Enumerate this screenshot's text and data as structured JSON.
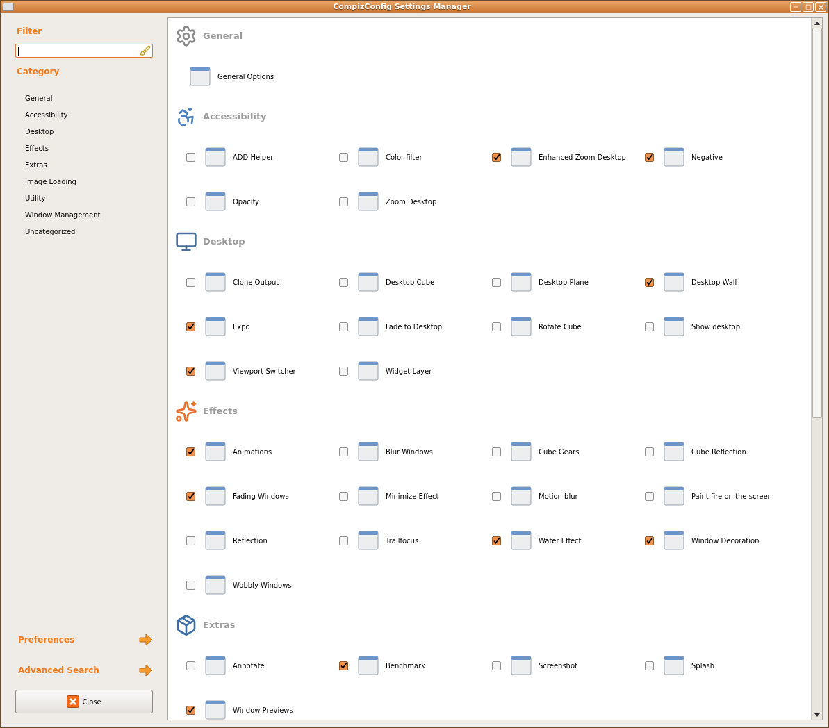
{
  "window": {
    "title": "CompizConfig Settings Manager"
  },
  "sidebar": {
    "filter_label": "Filter",
    "category_label": "Category",
    "categories": [
      "General",
      "Accessibility",
      "Desktop",
      "Effects",
      "Extras",
      "Image Loading",
      "Utility",
      "Window Management",
      "Uncategorized"
    ],
    "links": [
      "Preferences",
      "Advanced Search"
    ],
    "close_button": "Close"
  },
  "sections": [
    {
      "title": "General",
      "items": [
        {
          "label": "General Options",
          "kind": "plain"
        }
      ]
    },
    {
      "title": "Accessibility",
      "items": [
        {
          "label": "ADD Helper",
          "kind": "plugin",
          "checked": false
        },
        {
          "label": "Color filter",
          "kind": "plugin",
          "checked": false
        },
        {
          "label": "Enhanced Zoom Desktop",
          "kind": "plugin",
          "checked": true
        },
        {
          "label": "Negative",
          "kind": "plugin",
          "checked": true
        },
        {
          "label": "Opacify",
          "kind": "plugin",
          "checked": false
        },
        {
          "label": "Zoom Desktop",
          "kind": "plugin",
          "checked": false
        }
      ]
    },
    {
      "title": "Desktop",
      "items": [
        {
          "label": "Clone Output",
          "kind": "plugin",
          "checked": false
        },
        {
          "label": "Desktop Cube",
          "kind": "plugin",
          "checked": false
        },
        {
          "label": "Desktop Plane",
          "kind": "plugin",
          "checked": false
        },
        {
          "label": "Desktop Wall",
          "kind": "plugin",
          "checked": true
        },
        {
          "label": "Expo",
          "kind": "plugin",
          "checked": true
        },
        {
          "label": "Fade to Desktop",
          "kind": "plugin",
          "checked": false
        },
        {
          "label": "Rotate Cube",
          "kind": "plugin",
          "checked": false
        },
        {
          "label": "Show desktop",
          "kind": "plugin",
          "checked": false
        },
        {
          "label": "Viewport Switcher",
          "kind": "plugin",
          "checked": true
        },
        {
          "label": "Widget Layer",
          "kind": "plugin",
          "checked": false
        }
      ]
    },
    {
      "title": "Effects",
      "items": [
        {
          "label": "Animations",
          "kind": "plugin",
          "checked": true
        },
        {
          "label": "Blur Windows",
          "kind": "plugin",
          "checked": false
        },
        {
          "label": "Cube Gears",
          "kind": "plugin",
          "checked": false
        },
        {
          "label": "Cube Reflection",
          "kind": "plugin",
          "checked": false
        },
        {
          "label": "Fading Windows",
          "kind": "plugin",
          "checked": true
        },
        {
          "label": "Minimize Effect",
          "kind": "plugin",
          "checked": false
        },
        {
          "label": "Motion blur",
          "kind": "plugin",
          "checked": false
        },
        {
          "label": "Paint fire on the screen",
          "kind": "plugin",
          "checked": false
        },
        {
          "label": "Reflection",
          "kind": "plugin",
          "checked": false
        },
        {
          "label": "Trailfocus",
          "kind": "plugin",
          "checked": false
        },
        {
          "label": "Water Effect",
          "kind": "plugin",
          "checked": true
        },
        {
          "label": "Window Decoration",
          "kind": "plugin",
          "checked": true
        },
        {
          "label": "Wobbly Windows",
          "kind": "plugin",
          "checked": false
        }
      ]
    },
    {
      "title": "Extras",
      "items": [
        {
          "label": "Annotate",
          "kind": "plugin",
          "checked": false
        },
        {
          "label": "Benchmark",
          "kind": "plugin",
          "checked": true
        },
        {
          "label": "Screenshot",
          "kind": "plugin",
          "checked": false
        },
        {
          "label": "Splash",
          "kind": "plugin",
          "checked": false
        },
        {
          "label": "Window Previews",
          "kind": "plugin",
          "checked": true
        }
      ]
    }
  ]
}
